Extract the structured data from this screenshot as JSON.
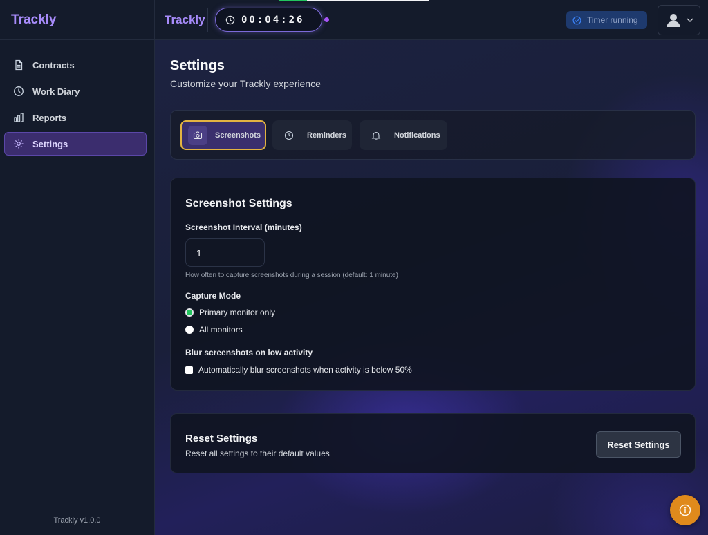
{
  "app": {
    "name": "Trackly",
    "version": "Trackly v1.0.0"
  },
  "sidebar": {
    "items": [
      {
        "label": "Contracts",
        "icon": "document-icon",
        "active": false
      },
      {
        "label": "Work Diary",
        "icon": "clock-icon",
        "active": false
      },
      {
        "label": "Reports",
        "icon": "bar-chart-icon",
        "active": false
      },
      {
        "label": "Settings",
        "icon": "gear-icon",
        "active": true
      }
    ]
  },
  "topbar": {
    "brand": "Trackly",
    "timer": "00:04:26",
    "status": "Timer running"
  },
  "page": {
    "title": "Settings",
    "subtitle": "Customize your Trackly experience"
  },
  "tabs": [
    {
      "label": "Screenshots",
      "icon": "camera-icon",
      "active": true
    },
    {
      "label": "Reminders",
      "icon": "clock-icon",
      "active": false
    },
    {
      "label": "Notifications",
      "icon": "bell-icon",
      "active": false
    }
  ],
  "screenshot_settings": {
    "title": "Screenshot Settings",
    "interval_label": "Screenshot Interval (minutes)",
    "interval_value": "1",
    "interval_help": "How often to capture screenshots during a session (default: 1 minute)",
    "capture_mode_label": "Capture Mode",
    "capture_options": [
      {
        "label": "Primary monitor only",
        "checked": true
      },
      {
        "label": "All monitors",
        "checked": false
      }
    ],
    "blur_label": "Blur screenshots on low activity",
    "blur_checkbox_label": "Automatically blur screenshots when activity is below 50%",
    "blur_checked": false
  },
  "reset": {
    "title": "Reset Settings",
    "subtitle": "Reset all settings to their default values",
    "button": "Reset Settings"
  },
  "colors": {
    "accent": "#a78bfa",
    "active_tab_border": "#e3b341",
    "radio_checked": "#22c55e",
    "fab": "#e08a1c"
  }
}
